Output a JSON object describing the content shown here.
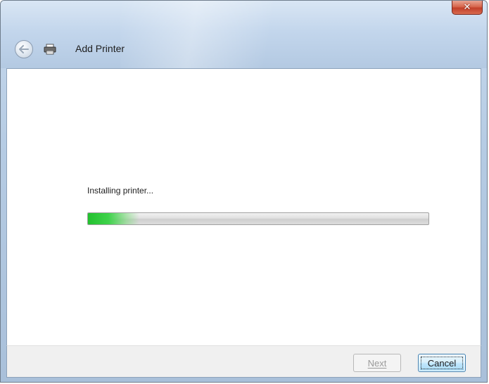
{
  "window": {
    "title": "Add Printer",
    "close_label": "✕",
    "title_icon": "printer-icon",
    "back_icon": "back-arrow-icon"
  },
  "content": {
    "status_text": "Installing printer...",
    "progress_fraction": 0.15
  },
  "buttons": {
    "next_label": "Next",
    "cancel_label": "Cancel"
  },
  "colors": {
    "progress_green": "#22c12e",
    "close_red": "#c2402a"
  }
}
